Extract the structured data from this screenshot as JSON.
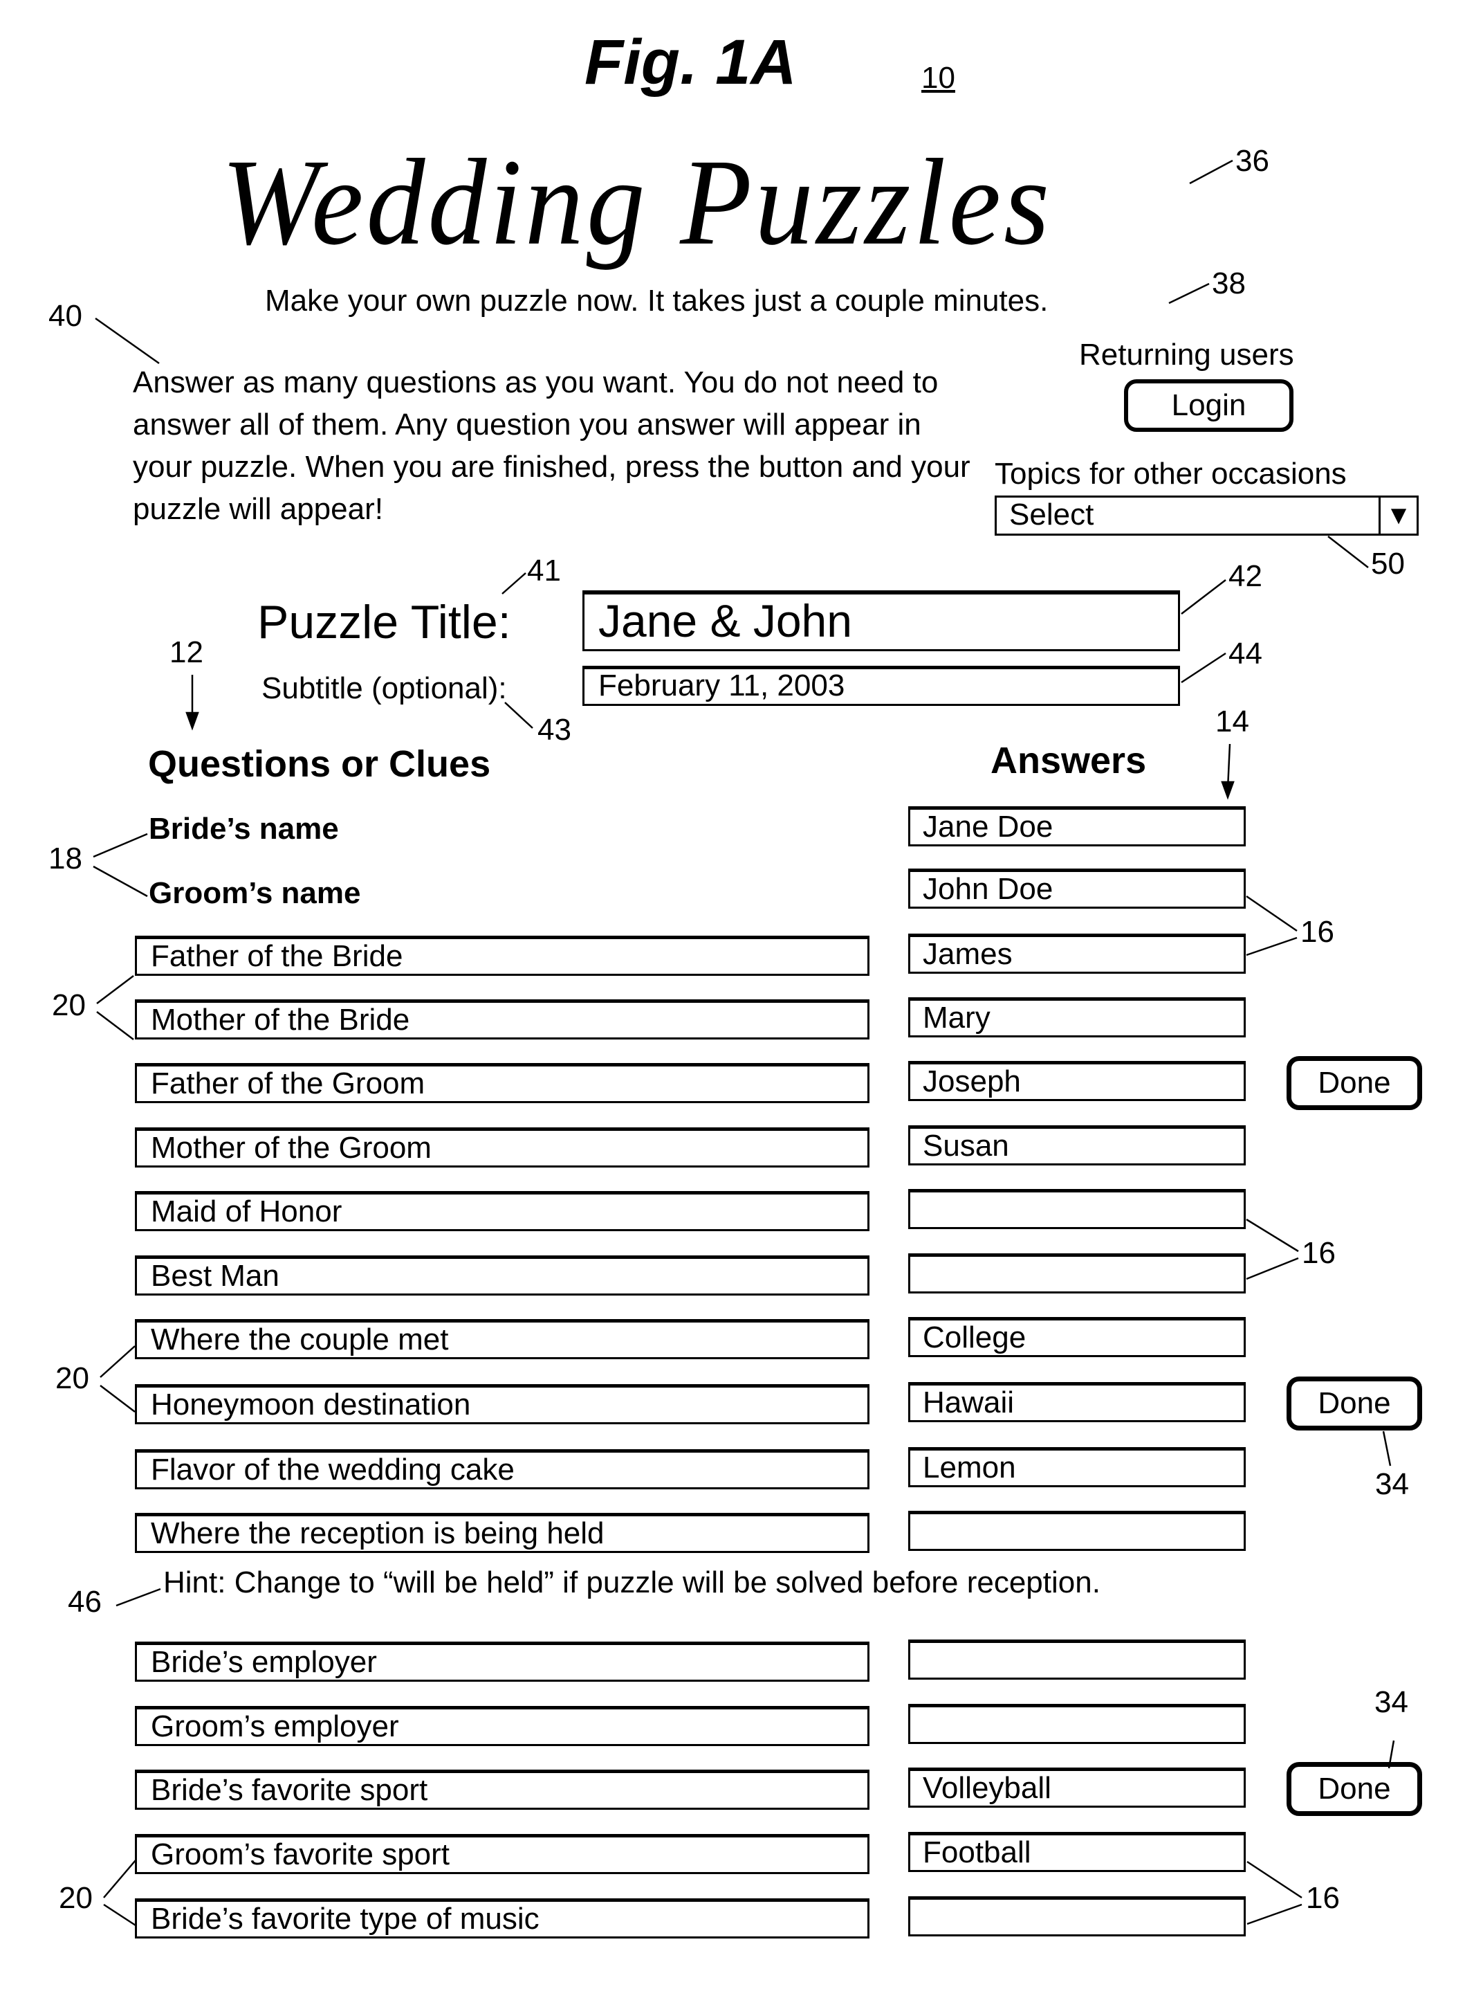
{
  "figure": {
    "title": "Fig. 1A",
    "reference": "10"
  },
  "header": {
    "brand": "Wedding Puzzles",
    "tagline": "Make your own puzzle now. It takes just a couple minutes.",
    "instructions": "Answer as many questions as you want. You do not need to answer all of them. Any question you answer will appear in your puzzle. When you are finished, press the button and your puzzle will appear!"
  },
  "account": {
    "returning_label": "Returning users",
    "login_label": "Login"
  },
  "topics": {
    "label": "Topics for other occasions",
    "selected": "Select",
    "arrow_icon": "▼"
  },
  "puzzle": {
    "title_label": "Puzzle Title:",
    "title_value": "Jane & John",
    "subtitle_label": "Subtitle (optional):",
    "subtitle_value": "February 11, 2003"
  },
  "columns": {
    "questions": "Questions or Clues",
    "answers": "Answers"
  },
  "fixed_questions": [
    {
      "question": "Bride’s name",
      "answer": "Jane Doe"
    },
    {
      "question": "Groom’s name",
      "answer": "John Doe"
    }
  ],
  "questions": [
    {
      "question": "Father of the Bride",
      "answer": "James"
    },
    {
      "question": "Mother of the Bride",
      "answer": "Mary"
    },
    {
      "question": "Father of the Groom",
      "answer": "Joseph"
    },
    {
      "question": "Mother of the Groom",
      "answer": "Susan"
    },
    {
      "question": "Maid of Honor",
      "answer": ""
    },
    {
      "question": "Best Man",
      "answer": ""
    },
    {
      "question": "Where the couple met",
      "answer": "College"
    },
    {
      "question": "Honeymoon destination",
      "answer": "Hawaii"
    },
    {
      "question": "Flavor of the wedding cake",
      "answer": "Lemon"
    },
    {
      "question": "Where the reception is being held",
      "answer": ""
    },
    {
      "question": "Bride’s employer",
      "answer": ""
    },
    {
      "question": "Groom’s employer",
      "answer": ""
    },
    {
      "question": "Bride’s favorite sport",
      "answer": "Volleyball"
    },
    {
      "question": "Groom’s favorite sport",
      "answer": "Football"
    },
    {
      "question": "Bride’s favorite type of music",
      "answer": ""
    }
  ],
  "hint": "Hint: Change to “will be held” if puzzle will be solved before reception.",
  "buttons": {
    "done_label": "Done"
  },
  "reference_numerals": {
    "r36": "36",
    "r38": "38",
    "r40": "40",
    "r41": "41",
    "r42": "42",
    "r43": "43",
    "r44": "44",
    "r50": "50",
    "r12": "12",
    "r14": "14",
    "r18": "18",
    "r20a": "20",
    "r20b": "20",
    "r20c": "20",
    "r16a": "16",
    "r16b": "16",
    "r16c": "16",
    "r34a": "34",
    "r34b": "34",
    "r46": "46"
  }
}
